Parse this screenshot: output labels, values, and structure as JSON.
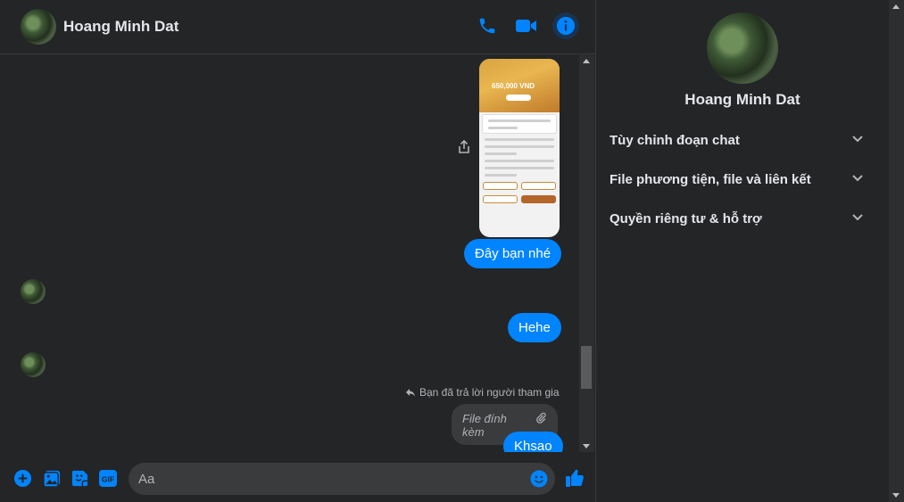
{
  "header": {
    "contact_name": "Hoang Minh Dat",
    "icons": [
      "phone-icon",
      "video-camera-icon",
      "info-icon"
    ]
  },
  "messages": {
    "image_amount": "650,000 VND",
    "bubble_1": "Đây bạn nhé",
    "bubble_2": "Hehe",
    "reply_note": "Bạn đã trả lời người tham gia",
    "attachment_label": "File đính kèm",
    "bubble_3": "Khsao"
  },
  "composer": {
    "placeholder": "Aa",
    "icons": [
      "plus-icon",
      "image-icon",
      "sticker-icon",
      "gif-icon",
      "emoji-icon",
      "like-icon"
    ],
    "gif_label": "GIF"
  },
  "info_panel": {
    "name": "Hoang Minh Dat",
    "sections": [
      {
        "label": "Tùy chỉnh đoạn chat"
      },
      {
        "label": "File phương tiện, file và liên kết"
      },
      {
        "label": "Quyền riêng tư & hỗ trợ"
      }
    ]
  },
  "colors": {
    "accent": "#0084ff",
    "background": "#242526",
    "bubble_gray": "#3a3b3c",
    "text": "#e4e6eb",
    "muted_text": "#b0b3b8"
  }
}
